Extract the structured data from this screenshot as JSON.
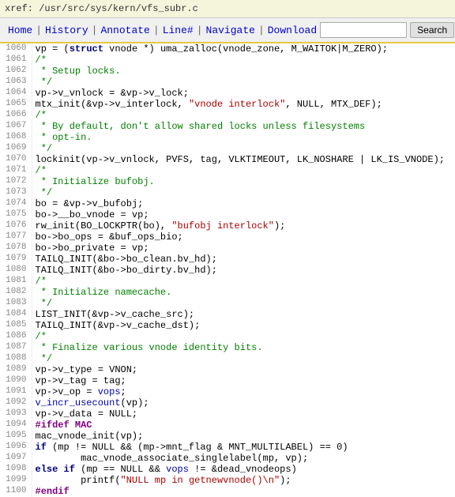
{
  "topbar": {
    "path": "xref: /usr/src/sys/kern/vfs_subr.c"
  },
  "navbar": {
    "home": "Home",
    "history": "History",
    "annotate": "Annotate",
    "linenum": "Line#",
    "navigate": "Navigate",
    "download": "Download",
    "search_placeholder": "",
    "search_btn": "Search"
  },
  "code": {
    "lines": [
      {
        "num": "1060",
        "text": "vp = (struct vnode *) uma_zalloc(vnode_zone, M_WAITOK|M_ZERO);"
      },
      {
        "num": "1061",
        "text": "/*"
      },
      {
        "num": "1062",
        "text": " * Setup locks."
      },
      {
        "num": "1063",
        "text": " */"
      },
      {
        "num": "1064",
        "text": "vp->v_vnlock = &vp->v_lock;"
      },
      {
        "num": "1065",
        "text": "mtx_init(&vp->v_interlock, \"vnode interlock\", NULL, MTX_DEF);"
      },
      {
        "num": "1066",
        "text": "/*"
      },
      {
        "num": "1067",
        "text": " * By default, don't allow shared locks unless filesystems"
      },
      {
        "num": "1068",
        "text": " * opt-in."
      },
      {
        "num": "1069",
        "text": " */"
      },
      {
        "num": "1070",
        "text": "lockinit(vp->v_vnlock, PVFS, tag, VLKTIMEOUT, LK_NOSHARE | LK_IS_VNODE);"
      },
      {
        "num": "1071",
        "text": "/*"
      },
      {
        "num": "1072",
        "text": " * Initialize bufobj."
      },
      {
        "num": "1073",
        "text": " */"
      },
      {
        "num": "1074",
        "text": "bo = &vp->v_bufobj;"
      },
      {
        "num": "1075",
        "text": "bo->__bo_vnode = vp;"
      },
      {
        "num": "1076",
        "text": "rw_init(BO_LOCKPTR(bo), \"bufobj interlock\");"
      },
      {
        "num": "1077",
        "text": "bo->bo_ops = &buf_ops_bio;"
      },
      {
        "num": "1078",
        "text": "bo->bo_private = vp;"
      },
      {
        "num": "1079",
        "text": "TAILQ_INIT(&bo->bo_clean.bv_hd);"
      },
      {
        "num": "1080",
        "text": "TAILQ_INIT(&bo->bo_dirty.bv_hd);"
      },
      {
        "num": "1081",
        "text": "/*"
      },
      {
        "num": "1082",
        "text": " * Initialize namecache."
      },
      {
        "num": "1083",
        "text": " */"
      },
      {
        "num": "1084",
        "text": "LIST_INIT(&vp->v_cache_src);"
      },
      {
        "num": "1085",
        "text": "TAILQ_INIT(&vp->v_cache_dst);"
      },
      {
        "num": "1086",
        "text": "/*"
      },
      {
        "num": "1087",
        "text": " * Finalize various vnode identity bits."
      },
      {
        "num": "1088",
        "text": " */"
      },
      {
        "num": "1089",
        "text": "vp->v_type = VNON;"
      },
      {
        "num": "1090",
        "text": "vp->v_tag = tag;"
      },
      {
        "num": "1091",
        "text": "vp->v_op = vops;"
      },
      {
        "num": "1092",
        "text": "v_incr_usecount(vp);"
      },
      {
        "num": "1093",
        "text": "vp->v_data = NULL;"
      },
      {
        "num": "1094",
        "text": "#ifdef MAC"
      },
      {
        "num": "1095",
        "text": "mac_vnode_init(vp);"
      },
      {
        "num": "1096",
        "text": "if (mp != NULL && (mp->mnt_flag & MNT_MULTILABEL) == 0)"
      },
      {
        "num": "1097",
        "text": "        mac_vnode_associate_singlelabel(mp, vp);"
      },
      {
        "num": "1098",
        "text": "else if (mp == NULL && vops != &dead_vnodeops)"
      },
      {
        "num": "1099",
        "text": "        printf(\"NULL mp in getnewvnode()\\n\");"
      },
      {
        "num": "1100",
        "text": "#endif"
      }
    ]
  }
}
